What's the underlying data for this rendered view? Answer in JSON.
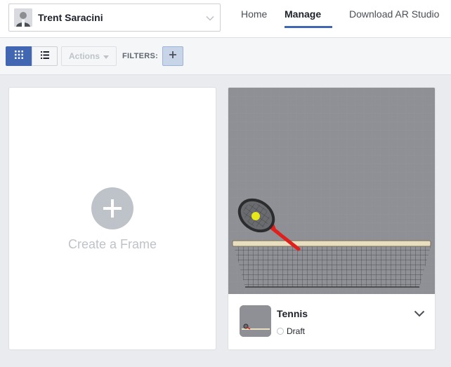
{
  "account": {
    "name": "Trent Saracini",
    "avatar_icon": "user-avatar",
    "caret_icon": "chevron-down-icon"
  },
  "nav": {
    "home": "Home",
    "manage": "Manage",
    "download": "Download AR Studio"
  },
  "toolbar": {
    "grid_icon": "grid-view-icon",
    "list_icon": "list-view-icon",
    "actions_label": "Actions",
    "filters_label": "FILTERS:",
    "add_filter_icon": "plus-icon"
  },
  "create_card": {
    "label": "Create a Frame",
    "icon": "plus-circle-icon"
  },
  "frames": [
    {
      "title": "Tennis",
      "status": "Draft",
      "menu_icon": "chevron-down-icon"
    }
  ],
  "colors": {
    "accent": "#4267b2",
    "background": "#e9ebee",
    "preview_bg": "#8e9095",
    "muted": "#bec3c9"
  }
}
